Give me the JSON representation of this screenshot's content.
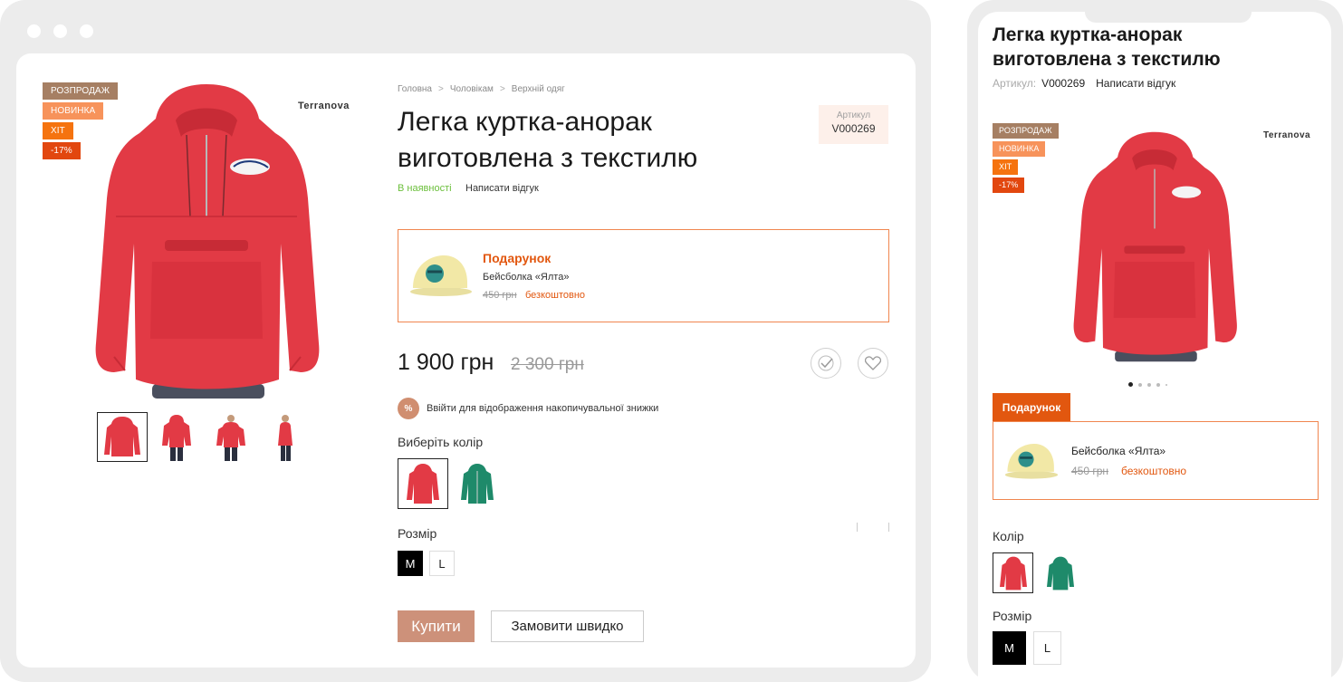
{
  "desktop": {
    "badges": [
      "РОЗПРОДАЖ",
      "НОВИНКА",
      "ХІТ",
      "-17%"
    ],
    "brand": "Terranova",
    "breadcrumb": [
      "Головна",
      "Чоловікам",
      "Верхній одяг"
    ],
    "breadcrumb_sep": ">",
    "title": "Легка куртка-анорак виготовлена з текстилю",
    "sku_label": "Артикул",
    "sku_value": "V000269",
    "stock": "В наявності",
    "review_link": "Написати відгук",
    "gift": {
      "title": "Подарунок",
      "name": "Бейсболка «Ялта»",
      "old_price": "450 грн",
      "free": "безкоштовно"
    },
    "price": "1 900 грн",
    "old_price": "2 300 грн",
    "loyalty_icon": "%",
    "loyalty_text": "Ввійти для відображення накопичувальної знижки",
    "color_label": "Виберіть колір",
    "size_label": "Розмір",
    "sizes": [
      "M",
      "L"
    ],
    "buy": "Купити",
    "quick_order": "Замовити швидко"
  },
  "mobile": {
    "title": "Легка куртка-анорак виготовлена з текстилю",
    "sku_label": "Артикул:",
    "sku_value": "V000269",
    "review_link": "Написати відгук",
    "badges": [
      "РОЗПРОДАЖ",
      "НОВИНКА",
      "ХІТ",
      "-17%"
    ],
    "brand": "Terranova",
    "gift_tab": "Подарунок",
    "gift_name": "Бейсболка «Ялта»",
    "gift_old_price": "450 грн",
    "gift_free": "безкоштовно",
    "color_label": "Колір",
    "size_label": "Розмір",
    "sizes": [
      "M",
      "L"
    ]
  },
  "colors": {
    "accent": "#e2570f",
    "buy_button": "#cd917a",
    "in_stock": "#6bbf3b",
    "jacket_red": "#e23a45",
    "jacket_green": "#1e8a6a"
  }
}
